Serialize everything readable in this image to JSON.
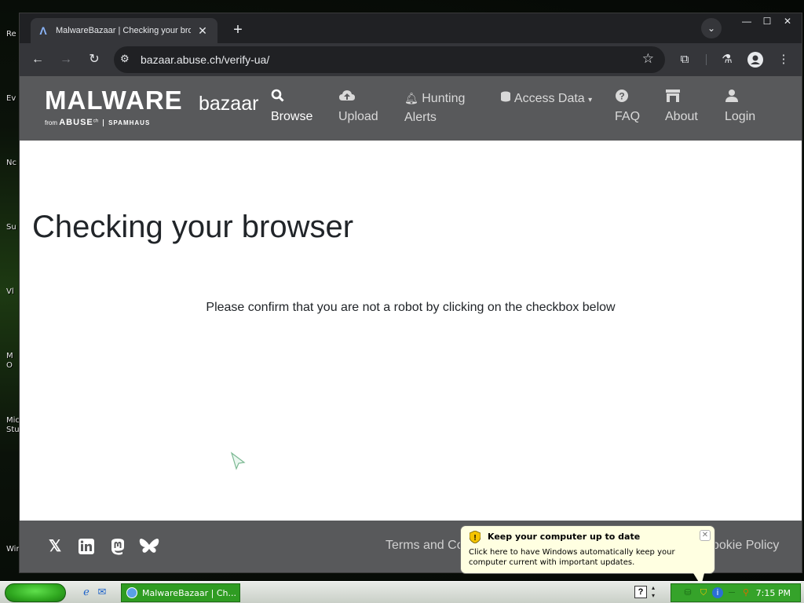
{
  "desktop": {
    "icon_labels": [
      "Re",
      "Ev",
      "Nc",
      "Su",
      "Vl",
      "M",
      "O",
      "Micro",
      "Stu",
      "Wind"
    ]
  },
  "browser": {
    "tab_title": "MalwareBazaar | Checking your browser",
    "tab_favicon": "Λ",
    "url": "bazaar.abuse.ch/verify-ua/"
  },
  "site": {
    "logo_main": "MALWARE",
    "logo_sub": "bazaar",
    "logo_from": "from",
    "logo_abuse": "ABUSE",
    "logo_abuse_sup": "ch",
    "logo_spamhaus": "SPAMHAUS",
    "nav": {
      "browse": "Browse",
      "upload": "Upload",
      "hunting_line1": "Hunting",
      "hunting_line2": "Alerts",
      "access_data": "Access Data",
      "faq": "FAQ",
      "about": "About",
      "login": "Login"
    },
    "heading": "Checking your browser",
    "confirm_text": "Please confirm that you are not a robot by clicking on the checkbox below",
    "footer": {
      "terms_prefix": "Terms and Co",
      "cookie_suffix": "ookie Policy"
    }
  },
  "balloon": {
    "title": "Keep your computer up to date",
    "text": "Click here to have Windows automatically keep your computer current with important updates."
  },
  "taskbar": {
    "task_label": "MalwareBazaar | Ch...",
    "clock": "7:15 PM"
  }
}
